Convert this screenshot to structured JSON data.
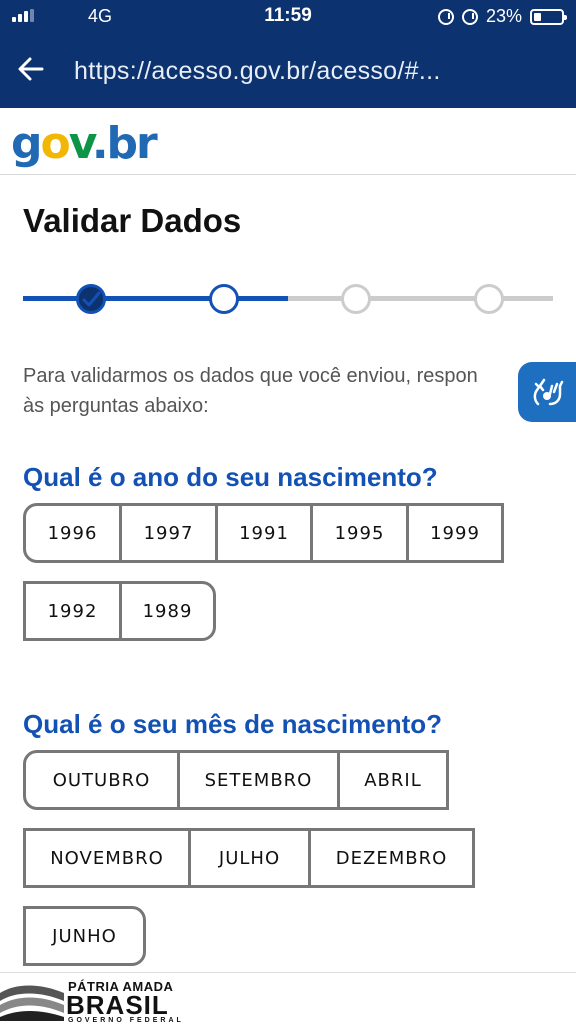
{
  "status": {
    "network": "4G",
    "time": "11:59",
    "battery": "23%"
  },
  "browser": {
    "url": "https://acesso.gov.br/acesso/#..."
  },
  "logo": {
    "g": "g",
    "o": "o",
    "v": "v",
    "dot": ".",
    "br": "br"
  },
  "page": {
    "title": "Validar Dados",
    "intro_line1": "Para validarmos os dados que você enviou, respon",
    "intro_line2": "às perguntas abaixo:"
  },
  "stepper": {
    "total_steps": 4,
    "current_step": 2,
    "completed": [
      1
    ]
  },
  "question_year": {
    "label": "Qual é o ano do seu nascimento?",
    "options": [
      "1996",
      "1997",
      "1991",
      "1995",
      "1999",
      "1992",
      "1989"
    ]
  },
  "question_month": {
    "label": "Qual é o seu mês de nascimento?",
    "options": [
      "OUTUBRO",
      "SETEMBRO",
      "ABRIL",
      "NOVEMBRO",
      "JULHO",
      "DEZEMBRO",
      "JUNHO"
    ]
  },
  "footer": {
    "line1": "PÁTRIA AMADA",
    "line2": "BRASIL",
    "line3": "GOVERNO FEDERAL"
  },
  "colors": {
    "brand_blue": "#1351b4",
    "topbar": "#0c326f",
    "step_inactive": "#cccccc",
    "vlibras": "#1e6fc0"
  },
  "icons": {
    "back": "arrow-left-icon",
    "vlibras": "sign-language-hands-icon",
    "check": "check-icon"
  }
}
